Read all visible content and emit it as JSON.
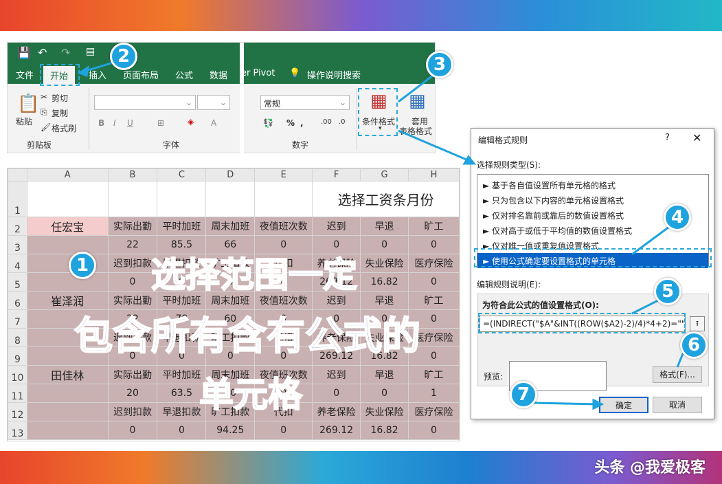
{
  "watermark": "头条 @我爱极客",
  "ribbon": {
    "tabs": [
      "文件",
      "开始",
      "插入",
      "页面布局",
      "公式",
      "数据",
      "er Pivot",
      "操作说明搜索"
    ],
    "paste": "粘贴",
    "cut": "剪切",
    "copy": "复制",
    "format_painter": "格式刷",
    "clipboard_group": "剪贴板",
    "font_group": "字体",
    "number_group": "数字",
    "number_format": "常规",
    "conditional_format": "条件格式",
    "table_format_1": "套用",
    "table_format_2": "表格格式",
    "font_btns": [
      "B",
      "I",
      "U"
    ]
  },
  "sheet": {
    "columns": [
      "A",
      "B",
      "C",
      "D",
      "E",
      "F",
      "G",
      "H"
    ],
    "rows": [
      {
        "n": "1",
        "cells": [
          "",
          "",
          "",
          "",
          "",
          "选择工资条月份",
          "",
          ""
        ]
      },
      {
        "n": "2",
        "cells": [
          "任宏宝",
          "实际出勤",
          "平时加班",
          "周末加班",
          "夜值班次数",
          "迟到",
          "早退",
          "旷工"
        ]
      },
      {
        "n": "3",
        "cells": [
          "",
          "22",
          "85.5",
          "66",
          "0",
          "0",
          "0",
          "0"
        ]
      },
      {
        "n": "4",
        "cells": [
          "",
          "迟到扣款",
          "早退扣款",
          "旷工扣款",
          "代扣",
          "养老保险",
          "失业保险",
          "医疗保险"
        ]
      },
      {
        "n": "5",
        "cells": [
          "",
          "0",
          "0",
          "0",
          "0",
          "269.12",
          "16.82",
          "0"
        ]
      },
      {
        "n": "6",
        "cells": [
          "崔泽润",
          "实际出勤",
          "平时加班",
          "周末加班",
          "夜值班次数",
          "迟到",
          "早退",
          "旷工"
        ]
      },
      {
        "n": "7",
        "cells": [
          "",
          "22",
          "78",
          "60",
          "0",
          "0",
          "0",
          "0"
        ]
      },
      {
        "n": "8",
        "cells": [
          "",
          "迟到扣款",
          "早退扣款",
          "旷工扣款",
          "代扣",
          "养老保险",
          "失业保险",
          "医疗保险"
        ]
      },
      {
        "n": "9",
        "cells": [
          "",
          "0",
          "0",
          "0",
          "0",
          "269.12",
          "16.82",
          "0"
        ]
      },
      {
        "n": "10",
        "cells": [
          "田佳林",
          "实际出勤",
          "平时加班",
          "周末加班",
          "夜值班次数",
          "迟到",
          "早退",
          "旷工"
        ]
      },
      {
        "n": "11",
        "cells": [
          "",
          "20",
          "63.5",
          "60",
          "0",
          "0",
          "0",
          "1"
        ]
      },
      {
        "n": "12",
        "cells": [
          "",
          "迟到扣款",
          "早退扣款",
          "旷工扣款",
          "代扣",
          "养老保险",
          "失业保险",
          "医疗保险"
        ]
      },
      {
        "n": "13",
        "cells": [
          "",
          "0",
          "0",
          "94.25",
          "0",
          "269.12",
          "16.82",
          "0"
        ]
      }
    ]
  },
  "overlay": {
    "line1": "选择范围一定",
    "line2": "包含所有含有公式的",
    "line3": "单元格"
  },
  "dialog": {
    "title": "编辑格式规则",
    "help": "?",
    "close": "✕",
    "rule_type_label": "选择规则类型(S):",
    "rules": [
      "► 基于各自值设置所有单元格的格式",
      "► 只为包含以下内容的单元格设置格式",
      "► 仅对排名靠前或靠后的数值设置格式",
      "► 仅对高于或低于平均值的数值设置格式",
      "► 仅对唯一值或重复值设置格式",
      "► 使用公式确定要设置格式的单元格"
    ],
    "desc_label": "编辑规则说明(E):",
    "formula_label": "为符合此公式的值设置格式(O):",
    "formula": "=(INDIRECT(\"$A\"&INT((ROW($A2)-2)/4)*4+2)=\"\")",
    "preview_label": "预览:",
    "format_btn": "格式(F)...",
    "ok_btn": "确定",
    "cancel_btn": "取消"
  },
  "badges": [
    "1",
    "2",
    "3",
    "4",
    "5",
    "6",
    "7"
  ],
  "colors": {
    "accent": "#1fa3de",
    "excel_green": "#217346",
    "selection": "#c9b0b1"
  }
}
